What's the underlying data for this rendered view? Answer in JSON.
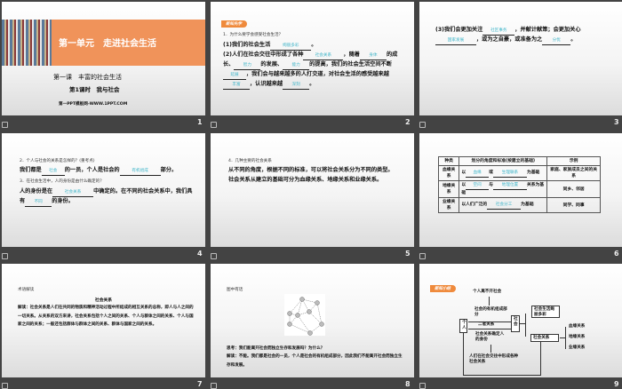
{
  "slides": [
    {
      "number": "1",
      "unit_title": "第一单元　走进社会生活",
      "lesson": "第一课　丰富的社会生活",
      "period": "第1课时　我与社会",
      "site": "第一PPT模板网-WWW.1PPT.COM"
    },
    {
      "number": "2",
      "badge": "新知先学",
      "q": "1．为什么要学会感受社会生活？",
      "p1a": "(1)我们的社会生活",
      "b1": "绚丽多彩",
      "p1b": "。",
      "p2a": "(2)人们在社会交往中形成了各种",
      "b2": "社会关系",
      "p2b": "，随着",
      "b3": "身体",
      "p2c": "的成长、",
      "b4": "智力",
      "p2d": "的发展、",
      "b5": "能力",
      "p2e": "的提高，我们的社会生活空间不断",
      "b6": "延展",
      "p2f": "，我们会与越来越多的人打交道，对社会生活的感受越来越",
      "b7": "丰富",
      "p2g": "，认识越来越",
      "b8": "深刻",
      "p2h": "。"
    },
    {
      "number": "3",
      "a": "(3)我们会更加关注",
      "b1": "社区事务",
      "c": "，并献计献策；会更加关心",
      "b2": "国家发展",
      "d": "，或为之自豪，或准备为之",
      "b3": "分忧",
      "e": "。"
    },
    {
      "number": "4",
      "q2": "2．个人与社会的关系是怎样的？(重考点)",
      "a1": "我们都是",
      "b1": "社会",
      "a2": "的一员，个人是社会的",
      "b2": "有机组成",
      "a3": "部分。",
      "q3": "3．在社会生活中，人的身份是由什么确定的？",
      "c1": "人的身份是在",
      "b3": "社会关系",
      "c2": "中确定的。在不同的社会关系中，我们具有",
      "b4": "不同",
      "c3": "的身份。"
    },
    {
      "number": "5",
      "q": "4．几种主要的社会关系",
      "body": "从不同的角度，根据不同的标准，可以将社会关系分为不同的类型。社会关系从建立的基础可分为血缘关系、地缘关系和业缘关系。"
    },
    {
      "number": "6",
      "headers": [
        "种类",
        "划分的角度和标准(按建立的基础)",
        "示例"
      ],
      "rows": [
        {
          "kind": "血缘关系",
          "pre": "以",
          "b1": "血缘",
          "mid": "或",
          "b2": "生理联系",
          "post": "为基础",
          "example": "家庭、家族成员之间的关系"
        },
        {
          "kind": "地缘关系",
          "pre": "以",
          "b1": "空间",
          "mid": "与",
          "b2": "地理位置",
          "post": "关系为基础",
          "example": "同乡、邻居"
        },
        {
          "kind": "业缘关系",
          "pre": "以人们广泛的",
          "b1": "社会分工",
          "post": "为基础",
          "example": "同学、同事"
        }
      ]
    },
    {
      "number": "7",
      "label": "术语解读",
      "term": "社会关系",
      "body": "解读：社会关系是人们在共同的物质和精神活动过程中所结成的相互关系的总称，即人与人之间的一切关系。从关系的双方来讲，社会关系包括个人之间的关系、个人与群体之间的关系、个人与国家之间的关系；一般还包括群体与群体之间的关系、群体与国家之间的关系。"
    },
    {
      "number": "8",
      "label": "图中有话",
      "think": "思考：我们能离开社会而独立生存和发展吗？为什么？",
      "answer": "解读：不能。我们都是社会的一员，个人是社会的有机组成部分，因此我们不能离开社会而独立生存和发展。"
    },
    {
      "number": "9",
      "badge": "新知小结",
      "top": "个人离不开社会",
      "organic": "社会的有机组成部分",
      "two_way": "二者关系",
      "identity": "社会关系确定人的身份",
      "formed": "人们在社会交往中形成各种社会关系",
      "individual": "个人",
      "society": "社会",
      "colorful": "社会生活绚丽多彩",
      "relations": "社会关系",
      "kinds": [
        "血缘关系",
        "地缘关系",
        "业缘关系"
      ]
    }
  ]
}
